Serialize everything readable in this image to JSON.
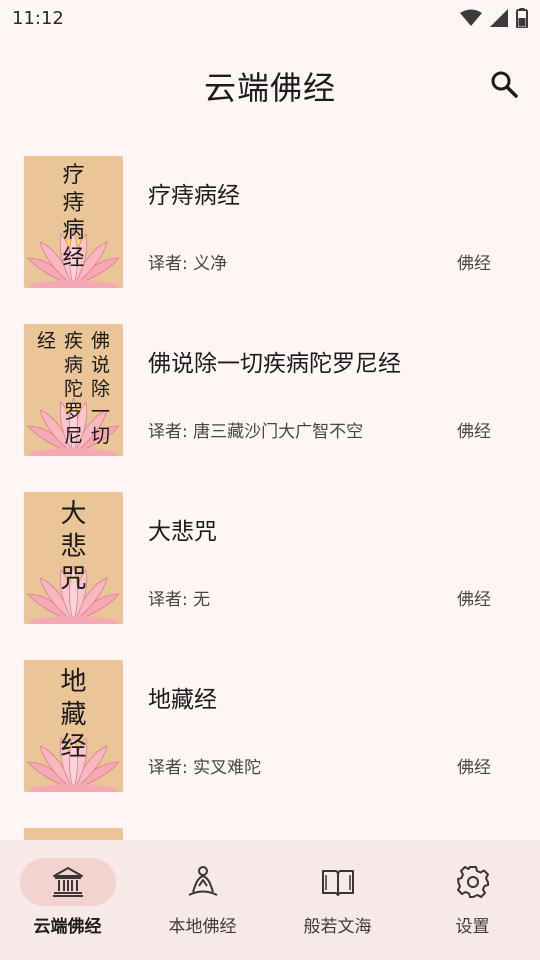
{
  "status_bar": {
    "time": "11:12",
    "icons": [
      "wifi-icon",
      "signal-icon",
      "battery-icon"
    ]
  },
  "app_bar": {
    "title": "云端佛经",
    "search_icon": "search-icon"
  },
  "sutras": [
    {
      "name": "疗痔病经",
      "translator": "译者: 义净",
      "category": "佛经",
      "cover_columns": [
        "疗痔病经"
      ]
    },
    {
      "name": "佛说除一切疾病陀罗尼经",
      "translator": "译者: 唐三藏沙门大广智不空",
      "category": "佛经",
      "cover_columns": [
        "佛说除一切",
        "疾病陀罗尼",
        "经"
      ]
    },
    {
      "name": "大悲咒",
      "translator": "译者: 无",
      "category": "佛经",
      "cover_columns": [
        "大悲咒"
      ]
    },
    {
      "name": "地藏经",
      "translator": "译者: 实叉难陀",
      "category": "佛经",
      "cover_columns": [
        "地藏经"
      ]
    }
  ],
  "bottom_nav": [
    {
      "label": "云端佛经",
      "icon": "temple-icon",
      "active": true
    },
    {
      "label": "本地佛经",
      "icon": "meditation-icon",
      "active": false
    },
    {
      "label": "般若文海",
      "icon": "book-icon",
      "active": false
    },
    {
      "label": "设置",
      "icon": "gear-icon",
      "active": false
    }
  ],
  "colors": {
    "background": "#fdf6f4",
    "cover": "#e9c598",
    "nav_background": "#f6e9e7",
    "nav_active_pill": "#f2d3cf",
    "lotus_pink": "#f09aa6"
  }
}
